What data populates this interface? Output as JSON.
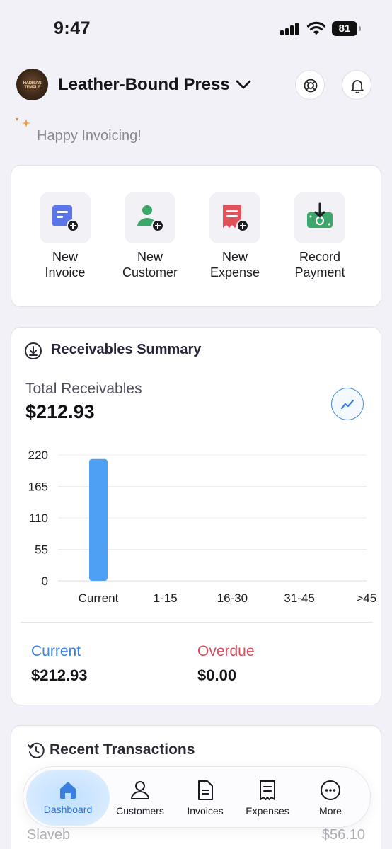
{
  "status_bar": {
    "time": "9:47",
    "battery": "81"
  },
  "header": {
    "avatar_text": "HADRIAN TEMPLE",
    "org_name": "Leather-Bound Press",
    "greeting": "Happy Invoicing!"
  },
  "quick_actions": [
    {
      "line1": "New",
      "line2": "Invoice",
      "icon": "new-invoice-icon",
      "color": "#5b74e8"
    },
    {
      "line1": "New",
      "line2": "Customer",
      "icon": "new-customer-icon",
      "color": "#3fa66b"
    },
    {
      "line1": "New",
      "line2": "Expense",
      "icon": "new-expense-icon",
      "color": "#e0525a"
    },
    {
      "line1": "Record",
      "line2": "Payment",
      "icon": "record-payment-icon",
      "color": "#3fa66b"
    }
  ],
  "receivables": {
    "title": "Receivables Summary",
    "total_label": "Total Receivables",
    "total_value": "$212.93",
    "current_label": "Current",
    "current_value": "$212.93",
    "overdue_label": "Overdue",
    "overdue_value": "$0.00"
  },
  "chart_data": {
    "type": "bar",
    "categories": [
      "Current",
      "1-15",
      "16-30",
      "31-45",
      ">45"
    ],
    "values": [
      212.93,
      0,
      0,
      0,
      0
    ],
    "yticks": [
      "0",
      "55",
      "110",
      "165",
      "220"
    ],
    "ylim": [
      0,
      220
    ],
    "grid": true,
    "bar_color": "#4ea0f5"
  },
  "recent": {
    "title": "Recent Transactions",
    "row_name": "Slaveb",
    "row_amount": "$56.10"
  },
  "tabs": [
    {
      "label": "Dashboard",
      "icon": "home-icon",
      "active": true
    },
    {
      "label": "Customers",
      "icon": "person-icon",
      "active": false
    },
    {
      "label": "Invoices",
      "icon": "document-icon",
      "active": false
    },
    {
      "label": "Expenses",
      "icon": "receipt-icon",
      "active": false
    },
    {
      "label": "More",
      "icon": "more-icon",
      "active": false
    }
  ]
}
